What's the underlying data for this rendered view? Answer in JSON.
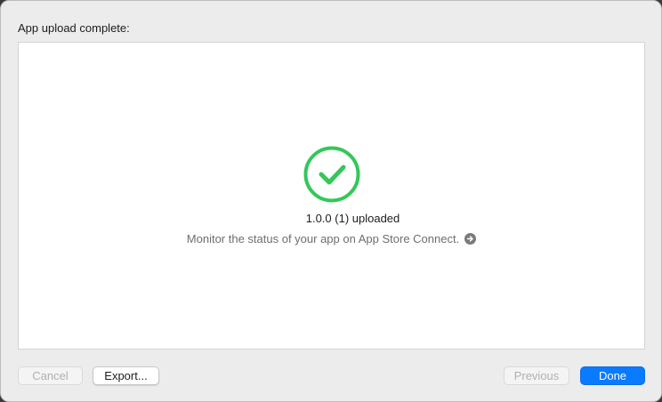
{
  "dialog": {
    "title": "App upload complete:"
  },
  "status": {
    "icon": "checkmark-circle-icon",
    "color": "#34c759",
    "uploaded_text": "1.0.0 (1) uploaded",
    "monitor_text": "Monitor the status of your app on App Store Connect."
  },
  "buttons": {
    "cancel": "Cancel",
    "export": "Export...",
    "previous": "Previous",
    "done": "Done"
  },
  "colors": {
    "accent": "#0a7aff",
    "success": "#34c759"
  }
}
